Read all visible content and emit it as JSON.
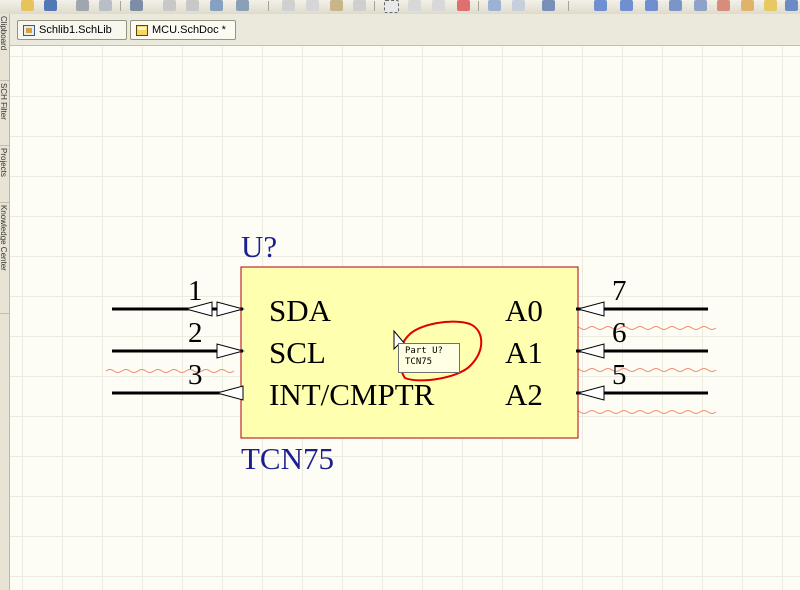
{
  "tabs": [
    {
      "label": "Schlib1.SchLib",
      "icon": "schlib-icon"
    },
    {
      "label": "MCU.SchDoc *",
      "icon": "schdoc-icon"
    }
  ],
  "side_panels": [
    "Clipboard",
    "SCH Filter",
    "Projects",
    "Knowledge Center"
  ],
  "component": {
    "designator": "U?",
    "comment": "TCN75",
    "body_color": "#ffffb0",
    "left_pins": [
      {
        "number": "1",
        "name": "SDA"
      },
      {
        "number": "2",
        "name": "SCL"
      },
      {
        "number": "3",
        "name": "INT/CMPTR"
      }
    ],
    "right_pins": [
      {
        "number": "7",
        "name": "A0"
      },
      {
        "number": "6",
        "name": "A1"
      },
      {
        "number": "5",
        "name": "A2"
      }
    ]
  },
  "tooltip": {
    "line1": "Part U?",
    "line2": "TCN75"
  },
  "colors": {
    "designator": "#1b1f91",
    "body_border": "#b40000",
    "annotation": "#e00000"
  }
}
